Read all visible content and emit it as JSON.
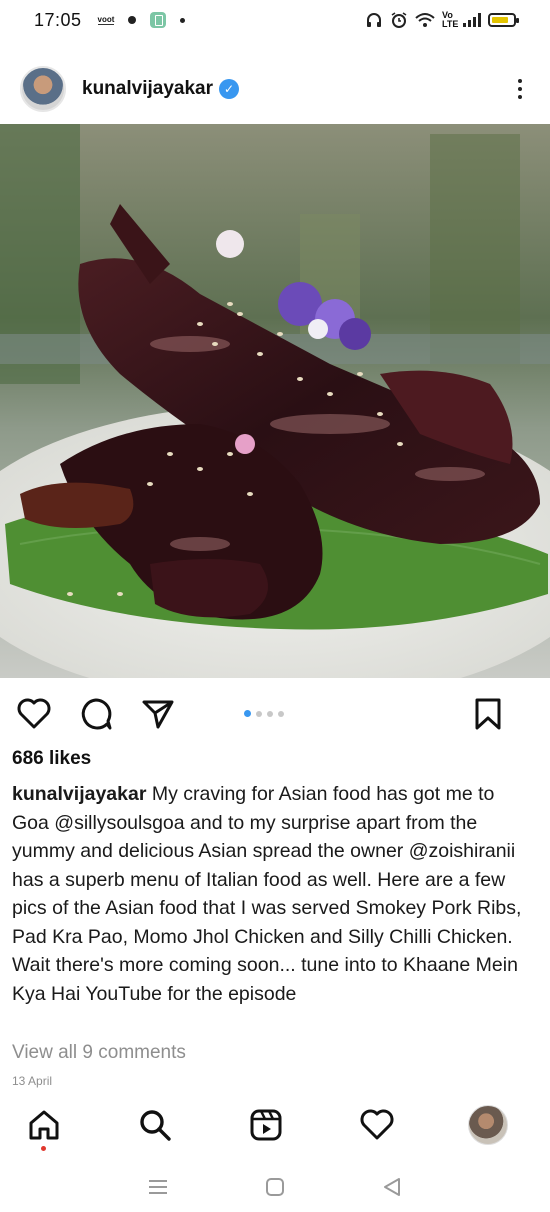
{
  "status_bar": {
    "time": "17:05",
    "carrier_tag": "voot",
    "network_label": "Vo LTE"
  },
  "post": {
    "username": "kunalvijayakar",
    "verified": true,
    "image_alt": "Smokey Pork Ribs glazed with sesame seeds and edible flowers on a banana leaf",
    "carousel": {
      "count": 4,
      "active_index": 0
    },
    "likes": "686 likes",
    "caption": {
      "user": "kunalvijayakar",
      "text": "My craving for Asian food has got me to Goa @sillysoulsgoa and to my surprise apart from the yummy and delicious Asian spread the owner @zoishiranii has a superb menu of Italian food as well. Here are a few pics of the Asian food that I was served Smokey Pork Ribs, Pad Kra Pao, Momo Jhol Chicken and Silly Chilli Chicken.",
      "line2": "Wait there's more coming soon... tune into to Khaane Mein Kya Hai YouTube for the episode"
    },
    "view_comments": "View all 9 comments",
    "date": "13 April"
  },
  "icons": {
    "like": "heart-icon",
    "comment": "comment-icon",
    "share": "send-icon",
    "save": "bookmark-icon",
    "more": "more-vertical-icon"
  },
  "bottom_nav": [
    "home",
    "search",
    "reels",
    "activity",
    "profile"
  ],
  "colors": {
    "accent": "#3897f0",
    "muted": "#8e8e8e",
    "notify": "#e0382e"
  }
}
